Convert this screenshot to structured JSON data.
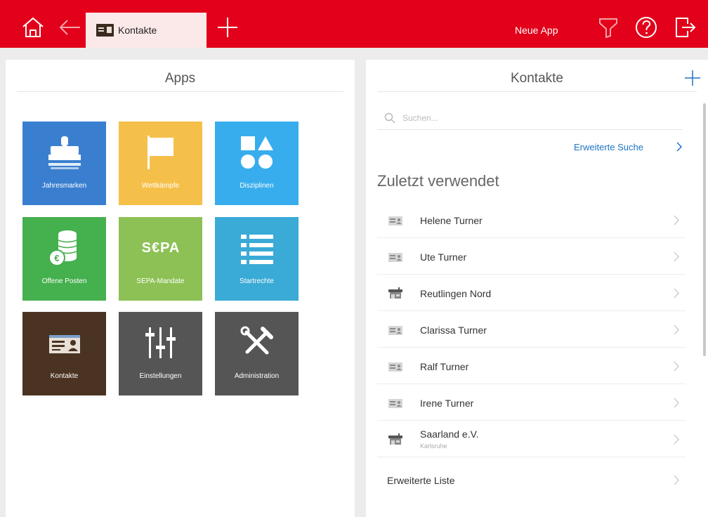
{
  "topbar": {
    "active_tab": "Kontakte",
    "neue_app": "Neue App",
    "color": "#e2001a"
  },
  "left": {
    "title": "Apps",
    "tiles": [
      {
        "label": "Jahresmarken",
        "color": "#3a7fcf",
        "icon": "stamp-icon"
      },
      {
        "label": "Wettkämpfe",
        "color": "#f5c04a",
        "icon": "flag-icon"
      },
      {
        "label": "Disziplinen",
        "color": "#37adee",
        "icon": "shapes-icon"
      },
      {
        "label": "Offene Posten",
        "color": "#45b04e",
        "icon": "coins-icon"
      },
      {
        "label": "SEPA-Mandate",
        "color": "#8dc155",
        "icon": "sepa-icon"
      },
      {
        "label": "Startrechte",
        "color": "#3aaad6",
        "icon": "list-icon"
      },
      {
        "label": "Kontakte",
        "color": "#4a3322",
        "icon": "contact-card-icon"
      },
      {
        "label": "Einstellungen",
        "color": "#555555",
        "icon": "sliders-icon"
      },
      {
        "label": "Administration",
        "color": "#555555",
        "icon": "tools-icon"
      }
    ]
  },
  "right": {
    "title": "Kontakte",
    "search_placeholder": "Suchen...",
    "advanced_search": "Erweiterte Suche",
    "section": "Zuletzt verwendet",
    "contacts": [
      {
        "name": "Helene Turner",
        "sub": "",
        "icon": "person-card-icon"
      },
      {
        "name": "Ute Turner",
        "sub": "",
        "icon": "person-card-icon"
      },
      {
        "name": "Reutlingen Nord",
        "sub": "",
        "icon": "club-icon"
      },
      {
        "name": "Clarissa Turner",
        "sub": "",
        "icon": "person-card-icon"
      },
      {
        "name": "Ralf Turner",
        "sub": "",
        "icon": "person-card-icon"
      },
      {
        "name": "Irene Turner",
        "sub": "",
        "icon": "person-card-icon"
      },
      {
        "name": "Saarland e.V.",
        "sub": "Karlsruhe",
        "icon": "club-icon"
      }
    ],
    "extended_list": "Erweiterte Liste",
    "link_color": "#1d74c4"
  }
}
